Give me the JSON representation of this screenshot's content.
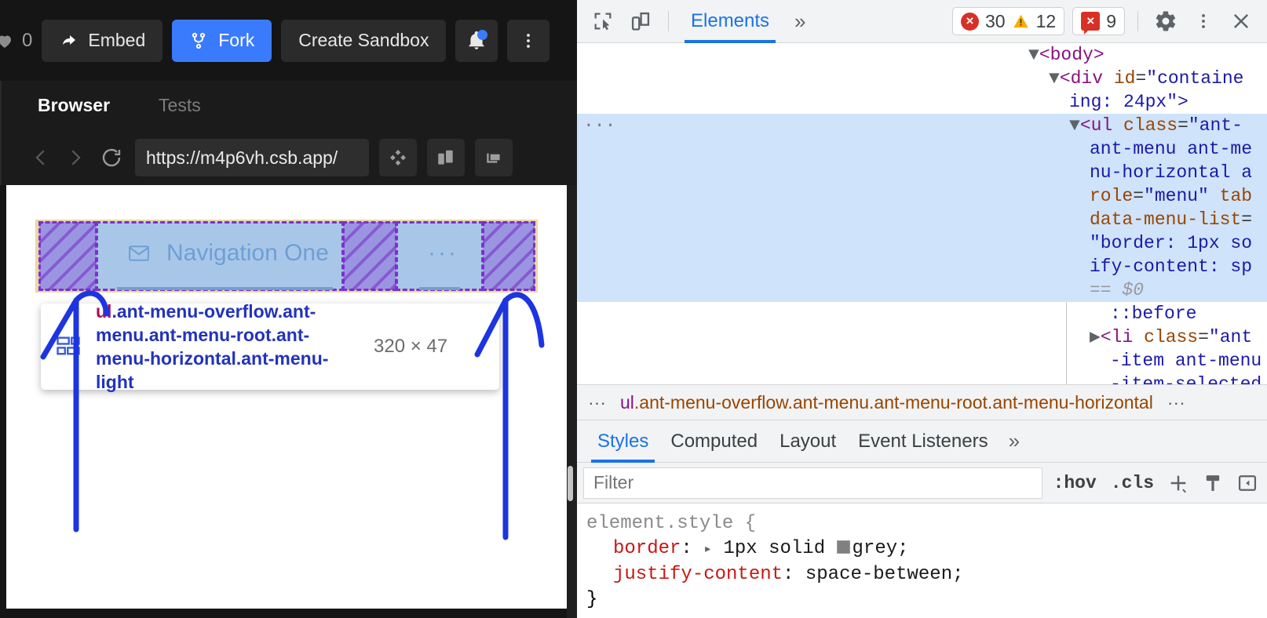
{
  "codesandbox": {
    "likes": "0",
    "heart_icon": "heart-icon",
    "buttons": {
      "embed": "Embed",
      "fork": "Fork",
      "create_sandbox": "Create Sandbox",
      "notifications_icon": "bell-icon",
      "more_icon": "kebab-menu-icon"
    },
    "tabs": [
      {
        "label": "Browser",
        "active": true
      },
      {
        "label": "Tests",
        "active": false
      }
    ],
    "browser_bar": {
      "back_icon": "chevron-left-icon",
      "forward_icon": "chevron-right-icon",
      "reload_icon": "reload-icon",
      "url": "https://m4p6vh.csb.app/",
      "url_placeholder": "https://",
      "responsive_icon": "responsive-preview-icon",
      "split_icon": "split-view-icon",
      "new_window_icon": "open-in-new-window-icon"
    }
  },
  "preview": {
    "menu": {
      "items": [
        {
          "label": "Navigation One",
          "icon": "mail-icon"
        },
        {
          "label": "···",
          "icon": "ellipsis-icon"
        }
      ]
    },
    "inspect_tooltip": {
      "badge_icon": "layout-badge-icon",
      "tag": "ul",
      "selector": ".ant-menu-overflow.ant-menu.ant-menu-root.ant-menu-horizontal.ant-menu-light",
      "dimensions": "320 × 47"
    },
    "colors": {
      "content_box": "#a8c7e8",
      "margin_box": "#9a95e0",
      "padding_box": "#e8d8a0",
      "dash_border": "#7d2fd0",
      "annotation": "#1d35e0"
    }
  },
  "devtools": {
    "toolbar": {
      "inspect_icon": "inspect-element-icon",
      "device_icon": "toggle-device-toolbar-icon",
      "settings_icon": "gear-icon",
      "more_icon": "kebab-menu-icon",
      "close_icon": "close-icon",
      "overflow_icon": "chevron-double-right-icon",
      "tabs": [
        {
          "label": "Elements",
          "active": true
        }
      ],
      "errors": "30",
      "warnings": "12",
      "issues": "9",
      "error_glyph": "×",
      "issue_glyph": "×"
    },
    "dom_lines": [
      {
        "indent": 0,
        "selected": false,
        "gutter": "",
        "html": "<span class='arrow-tri'>▼</span><span class='tagname2'>&lt;body&gt;</span>"
      },
      {
        "indent": 1,
        "selected": false,
        "gutter": "",
        "html": "<span class='arrow-tri'>▼</span><span class='tagname2'>&lt;div</span> <span class='attrname'>id</span><span class='punct'>=</span><span class='attrval'>\"containe</span>"
      },
      {
        "indent": 2,
        "selected": false,
        "gutter": "",
        "html": "<span class='attrval'>ing: 24px\"&gt;</span>"
      },
      {
        "indent": 2,
        "selected": true,
        "gutter": "···",
        "html": "<span class='arrow-tri'>▼</span><span class='tagname2'>&lt;ul</span> <span class='attrname'>class</span><span class='punct'>=</span><span class='attrval'>\"ant-</span>"
      },
      {
        "indent": 3,
        "selected": true,
        "gutter": "",
        "html": "<span class='attrval'>ant-menu ant-me</span>"
      },
      {
        "indent": 3,
        "selected": true,
        "gutter": "",
        "html": "<span class='attrval'>nu-horizontal a</span>"
      },
      {
        "indent": 3,
        "selected": true,
        "gutter": "",
        "html": "<span class='attrname'>role</span><span class='punct'>=</span><span class='attrval'>\"menu\"</span> <span class='attrname'>tab</span>"
      },
      {
        "indent": 3,
        "selected": true,
        "gutter": "",
        "html": "<span class='attrname'>data-menu-list</span><span class='punct'>=</span>"
      },
      {
        "indent": 3,
        "selected": true,
        "gutter": "",
        "html": "<span class='attrval'>\"border: 1px so</span>"
      },
      {
        "indent": 3,
        "selected": true,
        "gutter": "",
        "html": "<span class='attrval'>ify-content: sp</span>"
      },
      {
        "indent": 3,
        "selected": true,
        "gutter": "",
        "html": "<span class='eqdollar'>== $0</span>"
      },
      {
        "indent": 4,
        "selected": false,
        "gutter": "",
        "html": "<span class='pseudo'>::before</span>"
      },
      {
        "indent": 3,
        "selected": false,
        "gutter": "",
        "html": "<span class='arrow-tri'>▶</span><span class='tagname2'>&lt;li</span> <span class='attrname'>class</span><span class='punct'>=</span><span class='attrval'>\"ant</span>"
      },
      {
        "indent": 4,
        "selected": false,
        "gutter": "",
        "html": "<span class='attrval'>-item ant-menu</span>"
      },
      {
        "indent": 4,
        "selected": false,
        "gutter": "",
        "html": "<span class='attrval'>-item-selected</span>"
      }
    ],
    "breadcrumb": {
      "leading_dots": "···",
      "tag": "ul",
      "classes": ".ant-menu-overflow.ant-menu.ant-menu-root.ant-menu-horizontal",
      "trailing_dots": "···"
    },
    "styles_tabs": [
      {
        "label": "Styles",
        "active": true
      },
      {
        "label": "Computed",
        "active": false
      },
      {
        "label": "Layout",
        "active": false
      },
      {
        "label": "Event Listeners",
        "active": false
      }
    ],
    "styles_overflow_icon": "chevron-double-right-icon",
    "filter": {
      "placeholder": "Filter",
      "value": "",
      "hov_label": ":hov",
      "cls_label": ".cls",
      "new_rule_icon": "plus-icon",
      "class_icon": "style-class-icon",
      "sidebar_icon": "toggle-sidebar-icon"
    },
    "css_rule": {
      "selector": "element.style",
      "open_brace": "{",
      "close_brace": "}",
      "declarations": [
        {
          "property": "border",
          "value": "1px solid grey",
          "has_swatch": true,
          "has_expander": true
        },
        {
          "property": "justify-content",
          "value": "space-between",
          "has_swatch": false,
          "has_expander": false
        }
      ]
    }
  }
}
